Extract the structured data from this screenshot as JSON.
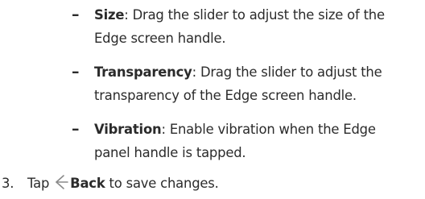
{
  "list": {
    "items": [
      {
        "term": "Size",
        "sep": ": ",
        "desc_line1": "Drag the slider to adjust the size of the",
        "desc_line2": "Edge screen handle."
      },
      {
        "term": "Transparency",
        "sep": ": ",
        "desc_line1": "Drag the slider to adjust the",
        "desc_line2": "transparency of the Edge screen handle."
      },
      {
        "term": "Vibration",
        "sep": ": ",
        "desc_line1": "Enable vibration when the Edge",
        "desc_line2": "panel handle is tapped."
      }
    ],
    "bullet": "–"
  },
  "step": {
    "number": "3.",
    "prefix": "Tap",
    "icon": "back-arrow-icon",
    "action": "Back",
    "suffix": " to save changes."
  },
  "colors": {
    "text": "#2b2b2b",
    "icon": "#8a8a8a"
  }
}
